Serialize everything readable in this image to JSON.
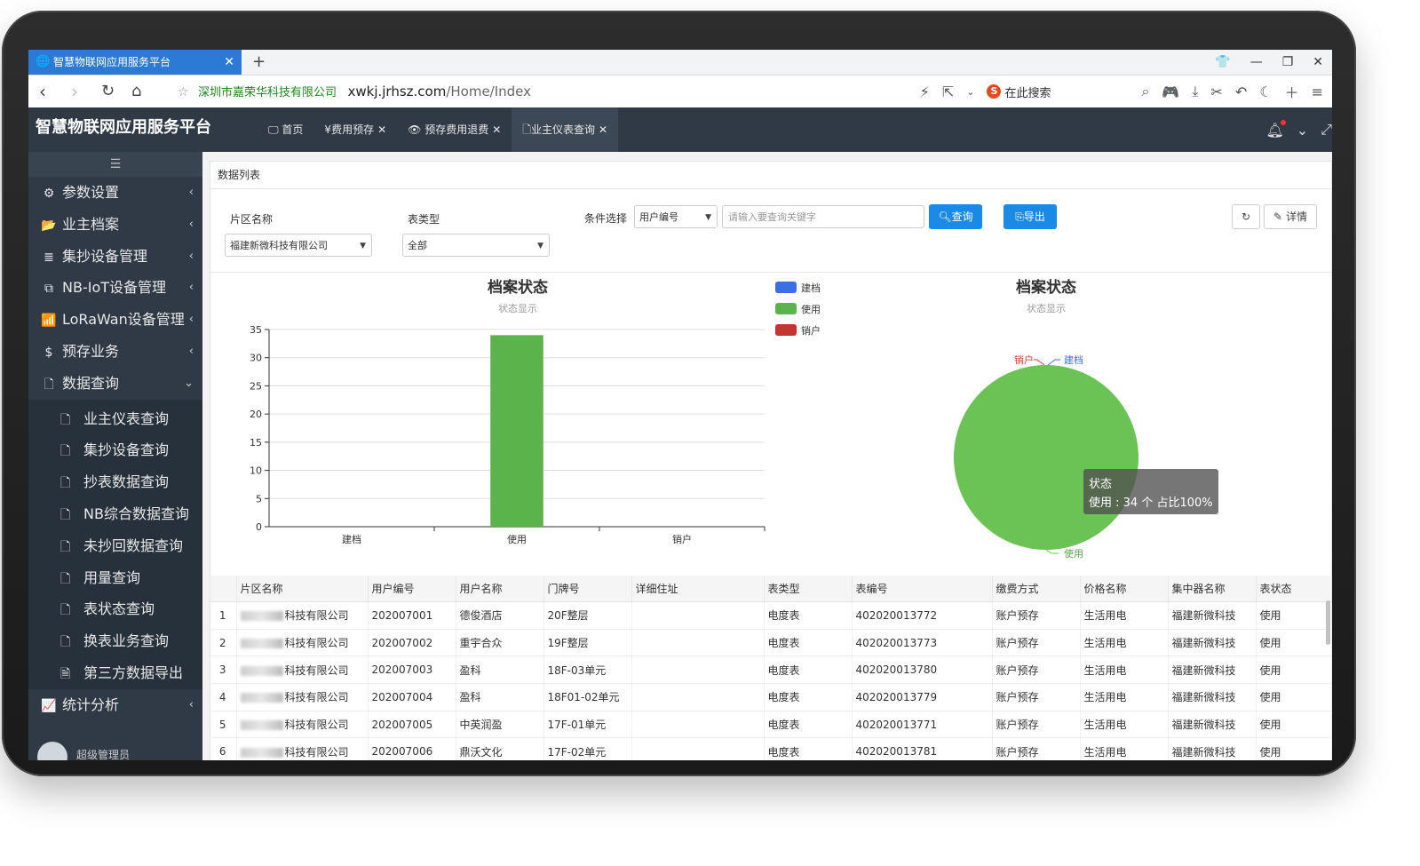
{
  "browser": {
    "tab_title": "智慧物联网应用服务平台",
    "site_name": "深圳市嘉荣华科技有限公司",
    "url_host": "xwkj.jrhsz.com",
    "url_path": "/Home/Index",
    "search_placeholder": "在此搜索"
  },
  "app": {
    "brand": "智慧物联网应用服务平台",
    "tabs": [
      {
        "icon": "🖵",
        "label": "首页",
        "closable": false
      },
      {
        "icon": "¥",
        "label": "费用预存",
        "closable": true
      },
      {
        "icon": "👁",
        "label": "预存费用退费",
        "closable": true
      },
      {
        "icon": "🗋",
        "label": "业主仪表查询",
        "closable": true,
        "active": true
      }
    ]
  },
  "sidebar": {
    "items": [
      {
        "icon": "gears-icon",
        "glyph": "⚙",
        "label": "参数设置"
      },
      {
        "icon": "folder-icon",
        "glyph": "📂",
        "label": "业主档案"
      },
      {
        "icon": "server-icon",
        "glyph": "≣",
        "label": "集抄设备管理"
      },
      {
        "icon": "clone-icon",
        "glyph": "⧉",
        "label": "NB-IoT设备管理"
      },
      {
        "icon": "wifi-icon",
        "glyph": "📶",
        "label": "LoRaWan设备管理"
      },
      {
        "icon": "dollar-icon",
        "glyph": "$",
        "label": "预存业务"
      },
      {
        "icon": "file-icon",
        "glyph": "🗋",
        "label": "数据查询",
        "expanded": true
      }
    ],
    "subitems": [
      {
        "glyph": "🗋",
        "label": "业主仪表查询"
      },
      {
        "glyph": "🗋",
        "label": "集抄设备查询"
      },
      {
        "glyph": "🗋",
        "label": "抄表数据查询"
      },
      {
        "glyph": "🗋",
        "label": "NB综合数据查询"
      },
      {
        "glyph": "🗋",
        "label": "未抄回数据查询"
      },
      {
        "glyph": "🗋",
        "label": "用量查询"
      },
      {
        "glyph": "🗋",
        "label": "表状态查询"
      },
      {
        "glyph": "🗋",
        "label": "换表业务查询"
      },
      {
        "glyph": "🗎",
        "label": "第三方数据导出"
      }
    ],
    "after": {
      "glyph": "📈",
      "label": "统计分析"
    },
    "user": "超级管理员"
  },
  "panel": {
    "title": "数据列表",
    "filters": {
      "area_label": "片区名称",
      "area_value": "福建新微科技有限公司",
      "type_label": "表类型",
      "type_value": "全部",
      "cond_label": "条件选择",
      "cond_value": "用户编号",
      "keyword_placeholder": "请输入要查询关键字",
      "query_button": "查询",
      "export_button": "导出",
      "detail_button": "详情"
    }
  },
  "chart_data": [
    {
      "type": "bar",
      "title": "档案状态",
      "subtitle": "状态显示",
      "categories": [
        "建档",
        "使用",
        "销户"
      ],
      "values": [
        0,
        34,
        0
      ],
      "colors": [
        "#3c6ee6",
        "#5ab44b",
        "#c23531"
      ],
      "ylim": [
        0,
        35
      ],
      "yticks": [
        0,
        5,
        10,
        15,
        20,
        25,
        30,
        35
      ],
      "legend": [
        "建档",
        "使用",
        "销户"
      ],
      "legend_colors": [
        "#3c6ee6",
        "#5ab44b",
        "#c23531"
      ]
    },
    {
      "type": "pie",
      "title": "档案状态",
      "subtitle": "状态显示",
      "labels": [
        "建档",
        "使用",
        "销户"
      ],
      "values": [
        0,
        34,
        0
      ],
      "colors": [
        "#3c6ee6",
        "#6cc355",
        "#e53935"
      ],
      "tooltip_title": "状态",
      "tooltip_text": "使用 : 34 个 占比100%"
    }
  ],
  "table": {
    "columns": [
      "",
      "片区名称",
      "用户编号",
      "用户名称",
      "门牌号",
      "详细住址",
      "表类型",
      "表编号",
      "缴费方式",
      "价格名称",
      "集中器名称",
      "表状态"
    ],
    "rows": [
      [
        "1",
        "科技有限公司",
        "202007001",
        "德俊酒店",
        "20F整层",
        "",
        "电度表",
        "402020013772",
        "账户预存",
        "生活用电",
        "福建新微科技",
        "使用"
      ],
      [
        "2",
        "科技有限公司",
        "202007002",
        "重宇合众",
        "19F整层",
        "",
        "电度表",
        "402020013773",
        "账户预存",
        "生活用电",
        "福建新微科技",
        "使用"
      ],
      [
        "3",
        "科技有限公司",
        "202007003",
        "盈科",
        "18F-03单元",
        "",
        "电度表",
        "402020013780",
        "账户预存",
        "生活用电",
        "福建新微科技",
        "使用"
      ],
      [
        "4",
        "科技有限公司",
        "202007004",
        "盈科",
        "18F01-02单元",
        "",
        "电度表",
        "402020013779",
        "账户预存",
        "生活用电",
        "福建新微科技",
        "使用"
      ],
      [
        "5",
        "科技有限公司",
        "202007005",
        "中英润盈",
        "17F-01单元",
        "",
        "电度表",
        "402020013771",
        "账户预存",
        "生活用电",
        "福建新微科技",
        "使用"
      ],
      [
        "6",
        "科技有限公司",
        "202007006",
        "鼎沃文化",
        "17F-02单元",
        "",
        "电度表",
        "402020013781",
        "账户预存",
        "生活用电",
        "福建新微科技",
        "使用"
      ]
    ]
  }
}
